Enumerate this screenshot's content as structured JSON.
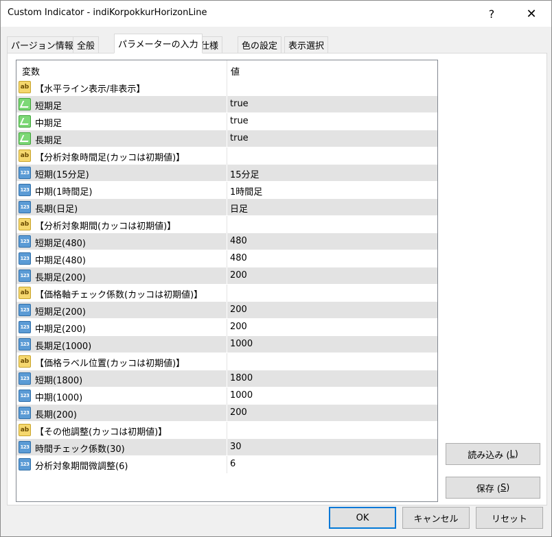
{
  "window": {
    "title": "Custom Indicator - indiKorpokkurHorizonLine",
    "help_glyph": "?",
    "close_glyph": "✕"
  },
  "tabs": [
    {
      "label": "パージョン情報"
    },
    {
      "label": "全般"
    },
    {
      "label": "パラメーターの入力",
      "active": true
    },
    {
      "label": "仕様"
    },
    {
      "label": "色の設定"
    },
    {
      "label": "表示選択"
    }
  ],
  "grid": {
    "header_variable": "変数",
    "header_value": "値",
    "rows": [
      {
        "icon": "ab",
        "name": "【水平ライン表示/非表示】",
        "value": ""
      },
      {
        "icon": "bool",
        "name": "短期足",
        "value": "true"
      },
      {
        "icon": "bool",
        "name": "中期足",
        "value": "true"
      },
      {
        "icon": "bool",
        "name": "長期足",
        "value": "true"
      },
      {
        "icon": "ab",
        "name": "【分析対象時間足(カッコは初期値)】",
        "value": ""
      },
      {
        "icon": "num",
        "name": "短期(15分足)",
        "value": "15分足"
      },
      {
        "icon": "num",
        "name": "中期(1時間足)",
        "value": "1時間足"
      },
      {
        "icon": "num",
        "name": "長期(日足)",
        "value": "日足"
      },
      {
        "icon": "ab",
        "name": "【分析対象期間(カッコは初期値)】",
        "value": ""
      },
      {
        "icon": "num",
        "name": "短期足(480)",
        "value": "480"
      },
      {
        "icon": "num",
        "name": "中期足(480)",
        "value": "480"
      },
      {
        "icon": "num",
        "name": "長期足(200)",
        "value": "200"
      },
      {
        "icon": "ab",
        "name": "【価格軸チェック係数(カッコは初期値)】",
        "value": ""
      },
      {
        "icon": "num",
        "name": "短期足(200)",
        "value": "200"
      },
      {
        "icon": "num",
        "name": "中期足(200)",
        "value": "200"
      },
      {
        "icon": "num",
        "name": "長期足(1000)",
        "value": "1000"
      },
      {
        "icon": "ab",
        "name": "【価格ラベル位置(カッコは初期値)】",
        "value": ""
      },
      {
        "icon": "num",
        "name": "短期(1800)",
        "value": "1800"
      },
      {
        "icon": "num",
        "name": "中期(1000)",
        "value": "1000"
      },
      {
        "icon": "num",
        "name": "長期(200)",
        "value": "200"
      },
      {
        "icon": "ab",
        "name": "【その他調整(カッコは初期値)】",
        "value": ""
      },
      {
        "icon": "num",
        "name": "時間チェック係数(30)",
        "value": "30"
      },
      {
        "icon": "num",
        "name": "分析対象期間微調整(6)",
        "value": "6"
      }
    ]
  },
  "icons": {
    "ab_text": "ab",
    "num_text": "123",
    "ab_name": "string-param-icon",
    "bool_name": "bool-param-icon",
    "num_name": "number-param-icon"
  },
  "buttons": {
    "load_label": "読み込み (",
    "load_key": "L",
    "load_suffix": ")",
    "save_label": "保存 (",
    "save_key": "S",
    "save_suffix": ")",
    "ok_label": "OK",
    "cancel_label": "キャンセル",
    "reset_label": "リセット"
  },
  "colors": {
    "accent": "#0078d7",
    "row_shade": "#e3e3e3"
  }
}
